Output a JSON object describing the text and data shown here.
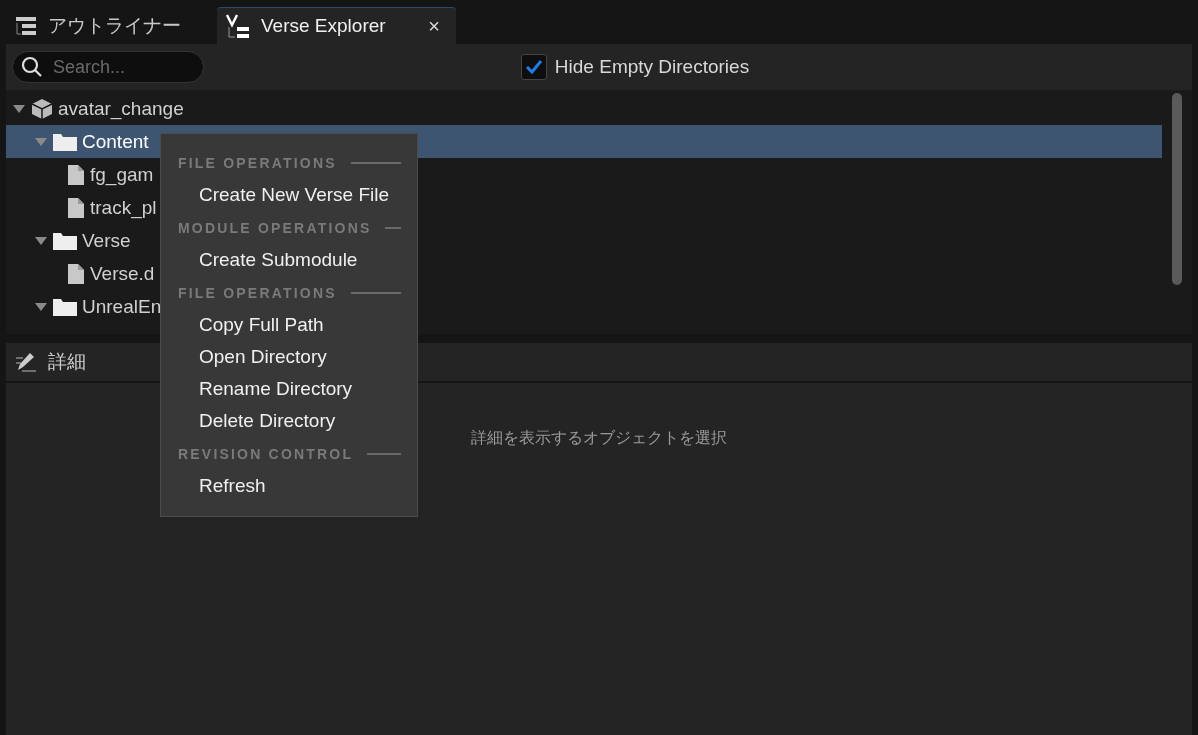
{
  "tabs": [
    {
      "label": "アウトライナー",
      "selected": false
    },
    {
      "label": "Verse Explorer",
      "selected": true,
      "close": "×"
    }
  ],
  "toolbar": {
    "search": {
      "placeholder": "Search..."
    },
    "hide_empty": {
      "label": "Hide Empty Directories",
      "checked": true
    }
  },
  "tree": [
    {
      "label": "avatar_change",
      "kind": "module",
      "expanded": true,
      "selected": false,
      "children": [
        {
          "label": "Content",
          "kind": "folder",
          "expanded": true,
          "selected": true,
          "children": [
            {
              "label": "fg_gam",
              "kind": "file",
              "selected": false
            },
            {
              "label": "track_pl",
              "kind": "file",
              "selected": false
            }
          ]
        },
        {
          "label": "Verse",
          "kind": "folder",
          "expanded": true,
          "selected": false,
          "children": [
            {
              "label": "Verse.d",
              "kind": "file",
              "selected": false
            }
          ]
        },
        {
          "label": "UnrealEn",
          "kind": "folder",
          "expanded": true,
          "selected": false
        }
      ]
    }
  ],
  "details": {
    "title": "詳細",
    "empty_message": "詳細を表示するオブジェクトを選択"
  },
  "context_menu": [
    {
      "kind": "header",
      "label": "FILE OPERATIONS"
    },
    {
      "kind": "item",
      "label": "Create New Verse File"
    },
    {
      "kind": "header",
      "label": "MODULE OPERATIONS"
    },
    {
      "kind": "item",
      "label": "Create Submodule"
    },
    {
      "kind": "header",
      "label": "FILE OPERATIONS"
    },
    {
      "kind": "item",
      "label": "Copy Full Path"
    },
    {
      "kind": "item",
      "label": "Open Directory"
    },
    {
      "kind": "item",
      "label": "Rename Directory"
    },
    {
      "kind": "item",
      "label": "Delete Directory"
    },
    {
      "kind": "header",
      "label": "REVISION CONTROL"
    },
    {
      "kind": "item",
      "label": "Refresh"
    }
  ]
}
